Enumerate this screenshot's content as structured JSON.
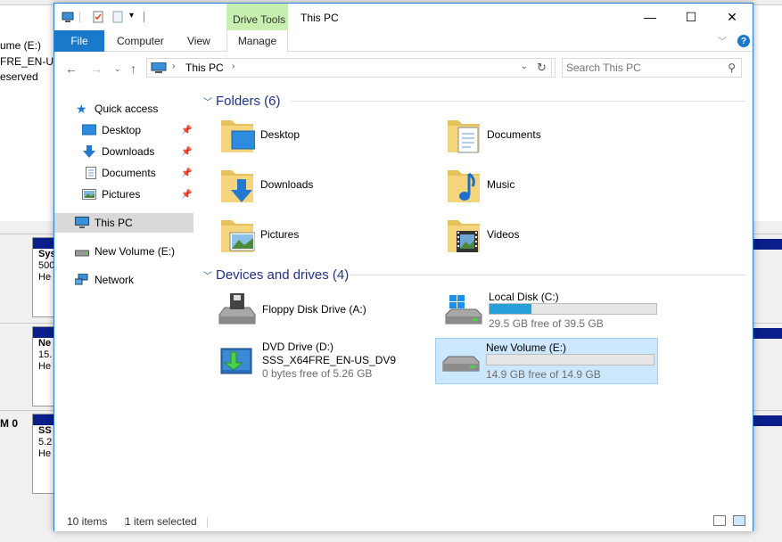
{
  "background_window": {
    "left_lines": [
      "ume (E:)",
      "FRE_EN-U...",
      "eserved"
    ],
    "disk_label": "M 0",
    "partitions": [
      {
        "l1": "Sys",
        "l2": "500",
        "l3": "He"
      },
      {
        "l1": "Ne",
        "l2": "15.",
        "l3": "He"
      },
      {
        "l1": "SS",
        "l2": "5.2",
        "l3": "He"
      }
    ]
  },
  "window": {
    "title": "This PC",
    "contextual_tab_group": "Drive Tools",
    "controls": {
      "minimize": "—",
      "maximize": "☐",
      "close": "✕"
    }
  },
  "ribbon": {
    "tabs": [
      {
        "id": "file",
        "label": "File"
      },
      {
        "id": "computer",
        "label": "Computer"
      },
      {
        "id": "view",
        "label": "View"
      },
      {
        "id": "manage",
        "label": "Manage"
      }
    ],
    "help": "?"
  },
  "navigation": {
    "address_crumb": "This PC",
    "search_placeholder": "Search This PC"
  },
  "nav_pane": {
    "items": [
      {
        "label": "Quick access",
        "icon": "star-icon"
      },
      {
        "label": "Desktop",
        "icon": "desktop-folder-icon",
        "pinned": true
      },
      {
        "label": "Downloads",
        "icon": "download-arrow-icon",
        "pinned": true
      },
      {
        "label": "Documents",
        "icon": "document-icon",
        "pinned": true
      },
      {
        "label": "Pictures",
        "icon": "picture-icon",
        "pinned": true
      },
      {
        "label": "This PC",
        "icon": "computer-icon",
        "selected": true
      },
      {
        "label": "New Volume (E:)",
        "icon": "drive-icon"
      },
      {
        "label": "Network",
        "icon": "network-icon"
      }
    ]
  },
  "content": {
    "folders_header": "Folders (6)",
    "folders": [
      {
        "name": "Desktop",
        "icon": "desktop-folder-icon"
      },
      {
        "name": "Documents",
        "icon": "documents-folder-icon"
      },
      {
        "name": "Downloads",
        "icon": "downloads-folder-icon"
      },
      {
        "name": "Music",
        "icon": "music-folder-icon"
      },
      {
        "name": "Pictures",
        "icon": "pictures-folder-icon"
      },
      {
        "name": "Videos",
        "icon": "videos-folder-icon"
      }
    ],
    "devices_header": "Devices and drives (4)",
    "drives": [
      {
        "name": "Floppy Disk Drive (A:)",
        "icon": "floppy-drive-icon"
      },
      {
        "name": "Local Disk (C:)",
        "free": "29.5 GB free of 39.5 GB",
        "used_fraction": 0.253,
        "icon": "windows-drive-icon"
      },
      {
        "name": "DVD Drive (D:)",
        "label": "SSS_X64FRE_EN-US_DV9",
        "free": "0 bytes free of 5.26 GB",
        "icon": "dvd-drive-icon"
      },
      {
        "name": "New Volume (E:)",
        "free": "14.9 GB free of 14.9 GB",
        "used_fraction": 0.0,
        "icon": "hard-drive-icon",
        "selected": true
      }
    ]
  },
  "status": {
    "items_count": "10 items",
    "selection": "1 item selected"
  },
  "colors": {
    "accent": "#1979ca",
    "drive_bar": "#26a0da",
    "selection": "#cce8ff",
    "header_text": "#1e3287",
    "drive_tools_tab": "#c6efb0"
  }
}
